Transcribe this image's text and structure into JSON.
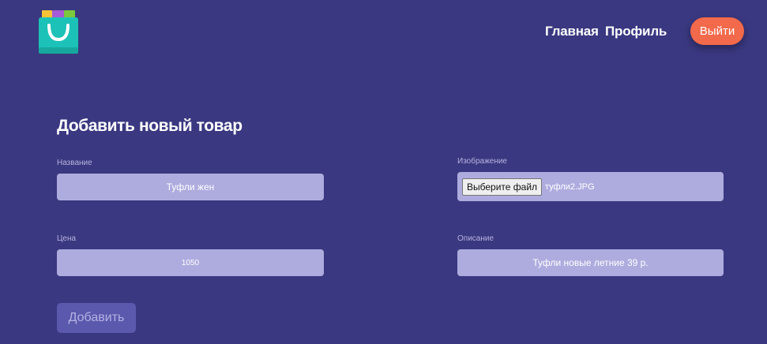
{
  "header": {
    "logo_icon": "shopping-bag-icon",
    "nav": {
      "home_label": "Главная",
      "profile_label": "Профиль"
    },
    "logout_label": "Выйти"
  },
  "form": {
    "title": "Добавить новый товар",
    "name": {
      "label": "Название",
      "value": "Туфли жен"
    },
    "image": {
      "label": "Изображение",
      "button_label": "Выберите файл",
      "file_name": "туфли2.JPG"
    },
    "price": {
      "label": "Цена",
      "value": "1050"
    },
    "description": {
      "label": "Описание",
      "value": "Туфли новые летние 39 р."
    },
    "submit_label": "Добавить"
  },
  "colors": {
    "background": "#3a3880",
    "input_bg": "#aeacde",
    "logout_button": "#f2694b",
    "submit_button": "#5b59ad"
  }
}
